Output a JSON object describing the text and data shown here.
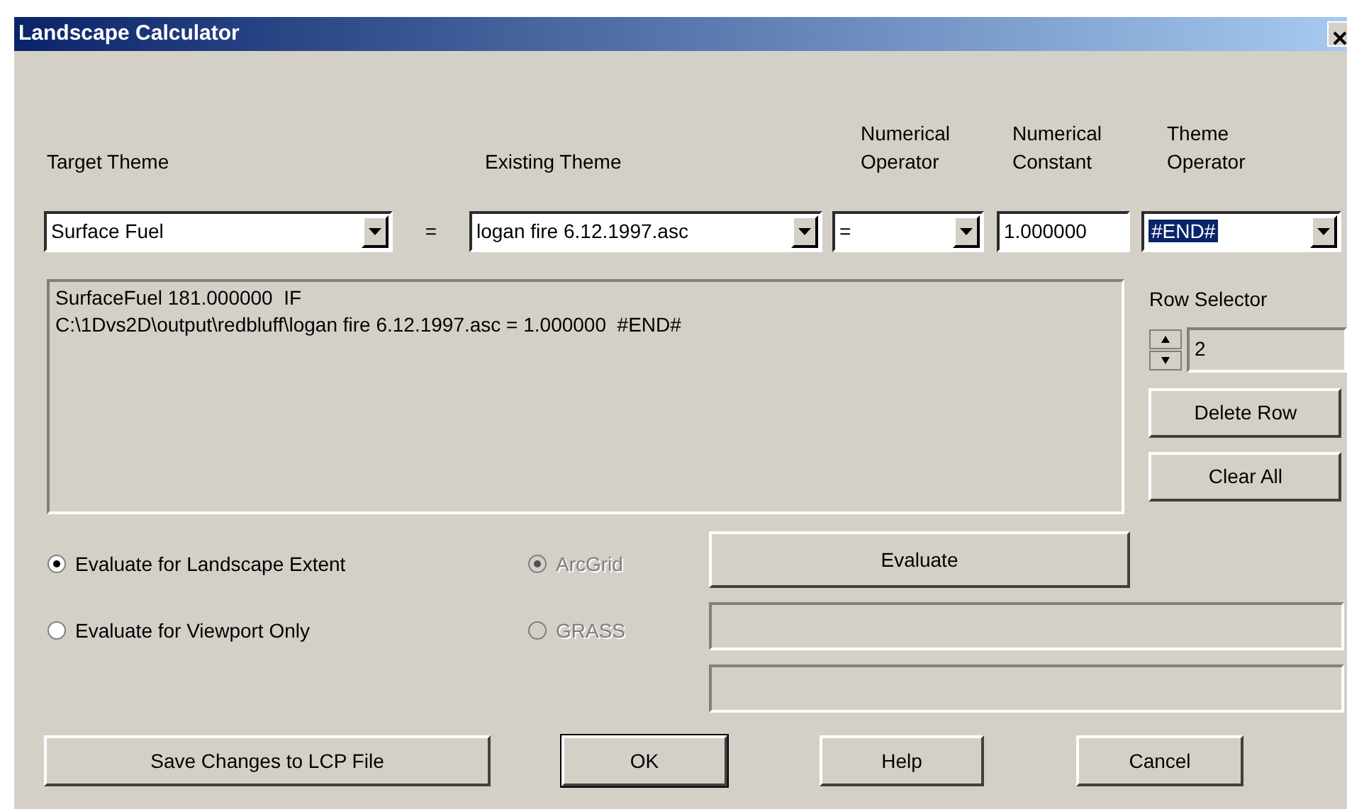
{
  "window": {
    "title": "Landscape Calculator"
  },
  "column_labels": [
    "Target Theme",
    "Existing Theme",
    "Numerical Operator",
    "Numerical Constant",
    "Theme Operator"
  ],
  "target_theme": {
    "value": "Surface Fuel"
  },
  "equals_sign": "=",
  "existing_theme": {
    "value": "logan fire 6.12.1997.asc"
  },
  "numerical_operator": {
    "value": "="
  },
  "numerical_constant": {
    "value": "1.000000"
  },
  "theme_operator": {
    "value": "#END#",
    "selected": true
  },
  "expression_lines": [
    "SurfaceFuel 181.000000  IF",
    "C:\\1Dvs2D\\output\\redbluff\\logan fire 6.12.1997.asc = 1.000000  #END#"
  ],
  "row_selector": {
    "label": "Row Selector",
    "value": "2"
  },
  "row_buttons": [
    "Delete Row",
    "Clear All"
  ],
  "extent_options": [
    {
      "label": "Evaluate for Landscape Extent",
      "selected": true,
      "disabled": false
    },
    {
      "label": "Evaluate for Viewport Only",
      "selected": false,
      "disabled": false
    }
  ],
  "format_options": [
    {
      "label": "ArcGrid",
      "selected": true,
      "disabled": true
    },
    {
      "label": "GRASS",
      "selected": false,
      "disabled": true
    }
  ],
  "evaluate_button": "Evaluate",
  "buttons": [
    {
      "label": "Save Changes to LCP File",
      "default": false
    },
    {
      "label": "OK",
      "default": true
    },
    {
      "label": "Help",
      "default": false
    },
    {
      "label": "Cancel",
      "default": false
    }
  ]
}
